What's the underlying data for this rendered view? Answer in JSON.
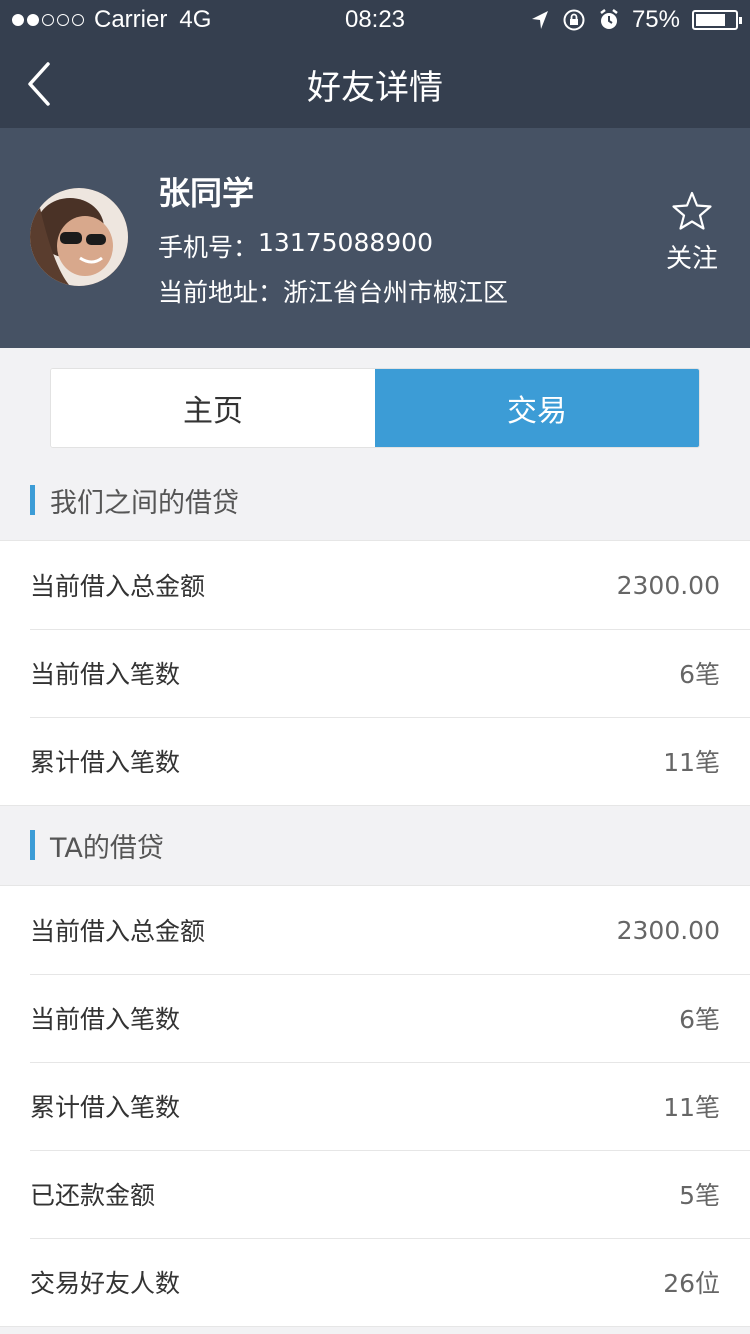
{
  "status_bar": {
    "carrier": "Carrier",
    "network": "4G",
    "time": "08:23",
    "battery": "75%",
    "battery_level": 0.75,
    "signal_filled": 2,
    "signal_total": 5
  },
  "nav": {
    "title": "好友详情",
    "back_icon": "chevron-left-icon"
  },
  "profile": {
    "name": "张同学",
    "phone_label": "手机号：",
    "phone": "13175088900",
    "address_label": "当前地址：",
    "address": "浙江省台州市椒江区",
    "follow_label": "关注",
    "follow_icon": "star-outline-icon"
  },
  "tabs": [
    {
      "label": "主页",
      "active": false
    },
    {
      "label": "交易",
      "active": true
    }
  ],
  "sections": [
    {
      "title": "我们之间的借贷",
      "rows": [
        {
          "label": "当前借入总金额",
          "value": "2300.00"
        },
        {
          "label": "当前借入笔数",
          "value": "6笔"
        },
        {
          "label": "累计借入笔数",
          "value": "11笔"
        }
      ]
    },
    {
      "title": "TA的借贷",
      "rows": [
        {
          "label": "当前借入总金额",
          "value": "2300.00"
        },
        {
          "label": "当前借入笔数",
          "value": "6笔"
        },
        {
          "label": "累计借入笔数",
          "value": "11笔"
        },
        {
          "label": "已还款金额",
          "value": "5笔"
        },
        {
          "label": "交易好友人数",
          "value": "26位"
        }
      ]
    }
  ],
  "colors": {
    "nav_bg": "#353f4f",
    "profile_bg": "#465264",
    "accent": "#3c9cd6",
    "page_bg": "#f2f2f4"
  }
}
